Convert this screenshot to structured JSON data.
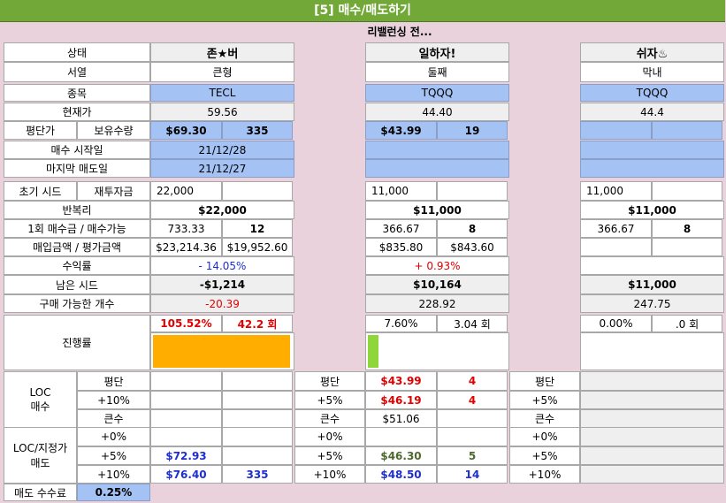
{
  "title": "[5] 매수/매도하기",
  "subtitle": "리밸런싱 전...",
  "labels": {
    "status": "상태",
    "order": "서열",
    "ticker": "종목",
    "price": "현재가",
    "avg": "평단가",
    "qty": "보유수량",
    "start": "매수 시작일",
    "last": "마지막 매도일",
    "seed": "초기 시드",
    "reinvest": "재투자금",
    "compound": "반복리",
    "once": "1회 매수금 / 매수가능",
    "buysum": "매입금액 / 평가금액",
    "profit": "수익률",
    "remain": "남은 시드",
    "buyable": "구매 가능한 개수",
    "progress": "진행률",
    "loc_buy": "LOC\n매수",
    "avg_short": "평단",
    "p10": "+10%",
    "big": "큰수",
    "loc_sell": "LOC/지정가\n매도",
    "s0": "+0%",
    "s5": "+5%",
    "s10": "+10%",
    "fee": "매도 수수료",
    "fee_val": "0.25%"
  },
  "mid": {
    "avg": "평단",
    "p5": "+5%",
    "big": "큰수",
    "s0": "+0%",
    "s5": "+5%",
    "s10": "+10%"
  },
  "accounts": [
    {
      "name": "존★버",
      "order": "큰형",
      "ticker": "TECL",
      "price": "59.56",
      "avg": "$69.30",
      "qty": "335",
      "start": "21/12/28",
      "last": "21/12/27",
      "seed": "22,000",
      "compound": "$22,000",
      "once": "733.33",
      "once_qty": "12",
      "buysum": "$23,214.36",
      "evalsum": "$19,952.60",
      "profit": "- 14.05%",
      "remain": "-$1,214",
      "buyable": "-20.39",
      "prog_pct": "105.52%",
      "prog_cnt": "42.2 회",
      "progress": 1.0,
      "bar_color": "#ffae00",
      "loc": {
        "avg": "",
        "avg_qty": "",
        "plus": "",
        "plus_qty": "",
        "big": ""
      },
      "sell": {
        "s0": "",
        "s0_qty": "",
        "s5": "$72.93",
        "s5_qty": "",
        "s10": "$76.40",
        "s10_qty": "335"
      }
    },
    {
      "name": "일하자!",
      "order": "둘째",
      "ticker": "TQQQ",
      "price": "44.40",
      "avg": "$43.99",
      "qty": "19",
      "start": "",
      "last": "",
      "seed": "11,000",
      "compound": "$11,000",
      "once": "366.67",
      "once_qty": "8",
      "buysum": "$835.80",
      "evalsum": "$843.60",
      "profit": "+ 0.93%",
      "remain": "$10,164",
      "buyable": "228.92",
      "prog_pct": "7.60%",
      "prog_cnt": "3.04 회",
      "progress": 0.076,
      "bar_color": "#8fd63a",
      "loc": {
        "avg": "$43.99",
        "avg_qty": "4",
        "plus": "$46.19",
        "plus_qty": "4",
        "big": "$51.06"
      },
      "sell": {
        "s0": "",
        "s0_qty": "",
        "s5": "$46.30",
        "s5_qty": "5",
        "s10": "$48.50",
        "s10_qty": "14"
      }
    },
    {
      "name": "쉬자♨",
      "order": "막내",
      "ticker": "TQQQ",
      "price": "44.4",
      "avg": "",
      "qty": "",
      "start": "",
      "last": "",
      "seed": "11,000",
      "compound": "$11,000",
      "once": "366.67",
      "once_qty": "8",
      "buysum": "",
      "evalsum": "",
      "profit": "",
      "remain": "$11,000",
      "buyable": "247.75",
      "prog_pct": "0.00%",
      "prog_cnt": ".0 회",
      "progress": 0,
      "bar_color": "#ffae00"
    }
  ]
}
